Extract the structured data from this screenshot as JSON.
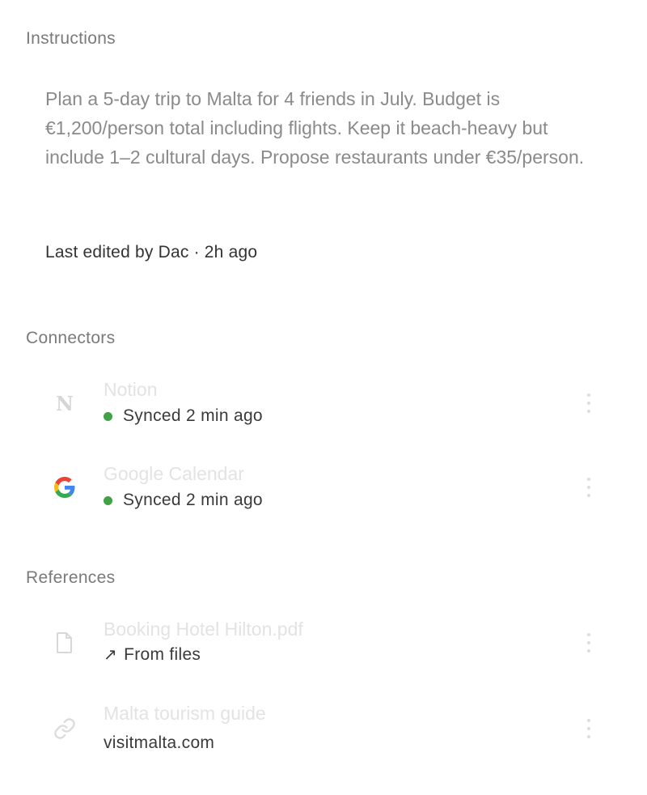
{
  "instructions": {
    "heading": "Instructions",
    "text": "Plan a 5-day trip to Malta for 4 friends in July. Budget is €1,200/person total including flights. Keep it beach-heavy but include 1–2 cultural days. Propose restaurants under €35/person.",
    "last_edited": "Last edited by Dac · 2h ago"
  },
  "connectors": {
    "heading": "Connectors",
    "items": [
      {
        "title": "Notion",
        "status": "Synced 2 min ago",
        "icon": "notion-icon",
        "status_color": "#43a047"
      },
      {
        "title": "Google Calendar",
        "status": "Synced 2 min ago",
        "icon": "google-icon",
        "status_color": "#43a047"
      }
    ]
  },
  "references": {
    "heading": "References",
    "items": [
      {
        "title": "Booking Hotel Hilton.pdf",
        "source": "From files",
        "icon": "file-icon",
        "source_icon": "arrow-up-right-icon"
      },
      {
        "title": "Malta tourism guide",
        "source": "visitmalta.com",
        "icon": "link-icon"
      }
    ]
  }
}
